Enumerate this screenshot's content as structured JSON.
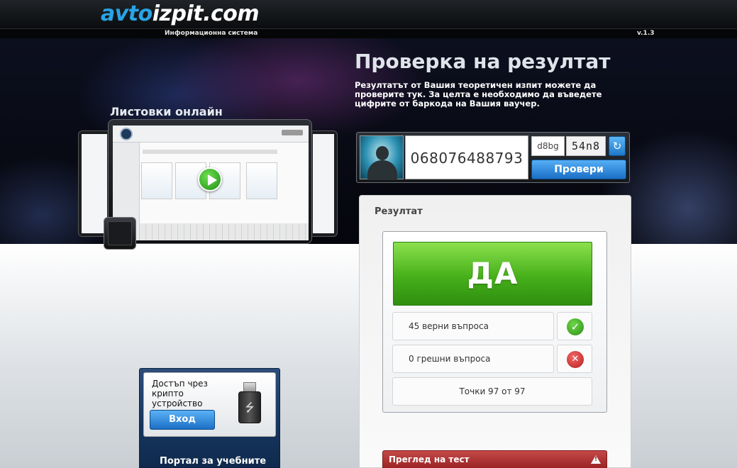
{
  "header": {
    "logo_prefix": "avto",
    "logo_rest": "izpit.com",
    "subtitle": "Информационна система",
    "version": "v.1.3"
  },
  "hero": {
    "title": "Проверка на резултат",
    "description": "Резултатът от Вашия теоретичен изпит можете да проверите тук. За целта е необходимо да въведете цифрите от баркода на Вашия ваучер.",
    "listovki_label": "Листовки онлайн"
  },
  "check_form": {
    "barcode_value": "068076488793",
    "captcha_input_value": "d8bg",
    "captcha_text": "54n8",
    "verify_label": "Провери",
    "icons": {
      "avatar": "user-silhouette-icon",
      "refresh": "refresh-icon"
    }
  },
  "result": {
    "heading": "Резултат",
    "verdict": "ДА",
    "correct_label": "45 верни въпроса",
    "wrong_label": "0 грешни въпроса",
    "points_label": "Точки 97 от 97",
    "review_label": "Преглед на тест",
    "colors": {
      "pass": "#46b01a",
      "review": "#b03636"
    }
  },
  "access": {
    "text": "Достъп чрез крипто устройство",
    "login_label": "Вход",
    "portal_label": "Портал за учебните",
    "icon": "usb-drive-icon"
  }
}
